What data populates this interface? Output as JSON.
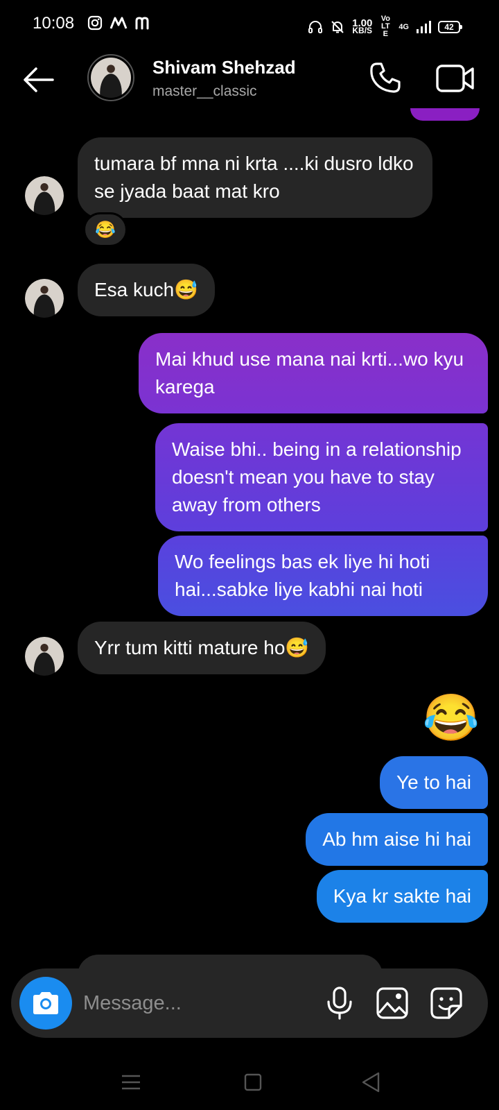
{
  "status_bar": {
    "time": "10:08",
    "net_speed_value": "1.00",
    "net_speed_unit": "KB/S",
    "volte": "Vo LTE",
    "network": "4G",
    "battery": "42"
  },
  "header": {
    "name": "Shivam Shehzad",
    "handle": "master__classic"
  },
  "messages": [
    {
      "direction": "in",
      "text": "tumara bf mna ni krta ....ki dusro ldko se jyada baat mat kro",
      "reaction": "😂"
    },
    {
      "direction": "in",
      "text": "Esa kuch😅"
    },
    {
      "direction": "out",
      "text": "Mai khud use mana nai krti...wo kyu karega"
    },
    {
      "direction": "out",
      "text": "Waise bhi.. being in a relationship doesn't mean you have to stay away from others"
    },
    {
      "direction": "out",
      "text": "Wo feelings bas ek liye hi hoti hai...sabke liye kabhi nai hoti"
    },
    {
      "direction": "in",
      "text": "Yrr tum kitti mature ho😅"
    },
    {
      "direction": "out",
      "text": "😂",
      "emoji_only": true
    },
    {
      "direction": "out",
      "text": "Ye to hai"
    },
    {
      "direction": "out",
      "text": "Ab hm aise hi hai"
    },
    {
      "direction": "out",
      "text": "Kya kr sakte hai"
    }
  ],
  "composer": {
    "placeholder": "Message..."
  },
  "colors": {
    "background": "#000000",
    "incoming_bubble": "#262626",
    "outgoing_gradient_top": "#8a2fc9",
    "outgoing_gradient_bottom": "#1c82e8",
    "camera_button": "#1a8cf0",
    "secondary_text": "#a8a8a8"
  },
  "icons": {
    "back": "arrow-left-icon",
    "call": "phone-icon",
    "video": "video-camera-icon",
    "camera": "camera-icon",
    "mic": "microphone-icon",
    "gallery": "image-icon",
    "sticker": "sticker-icon"
  }
}
